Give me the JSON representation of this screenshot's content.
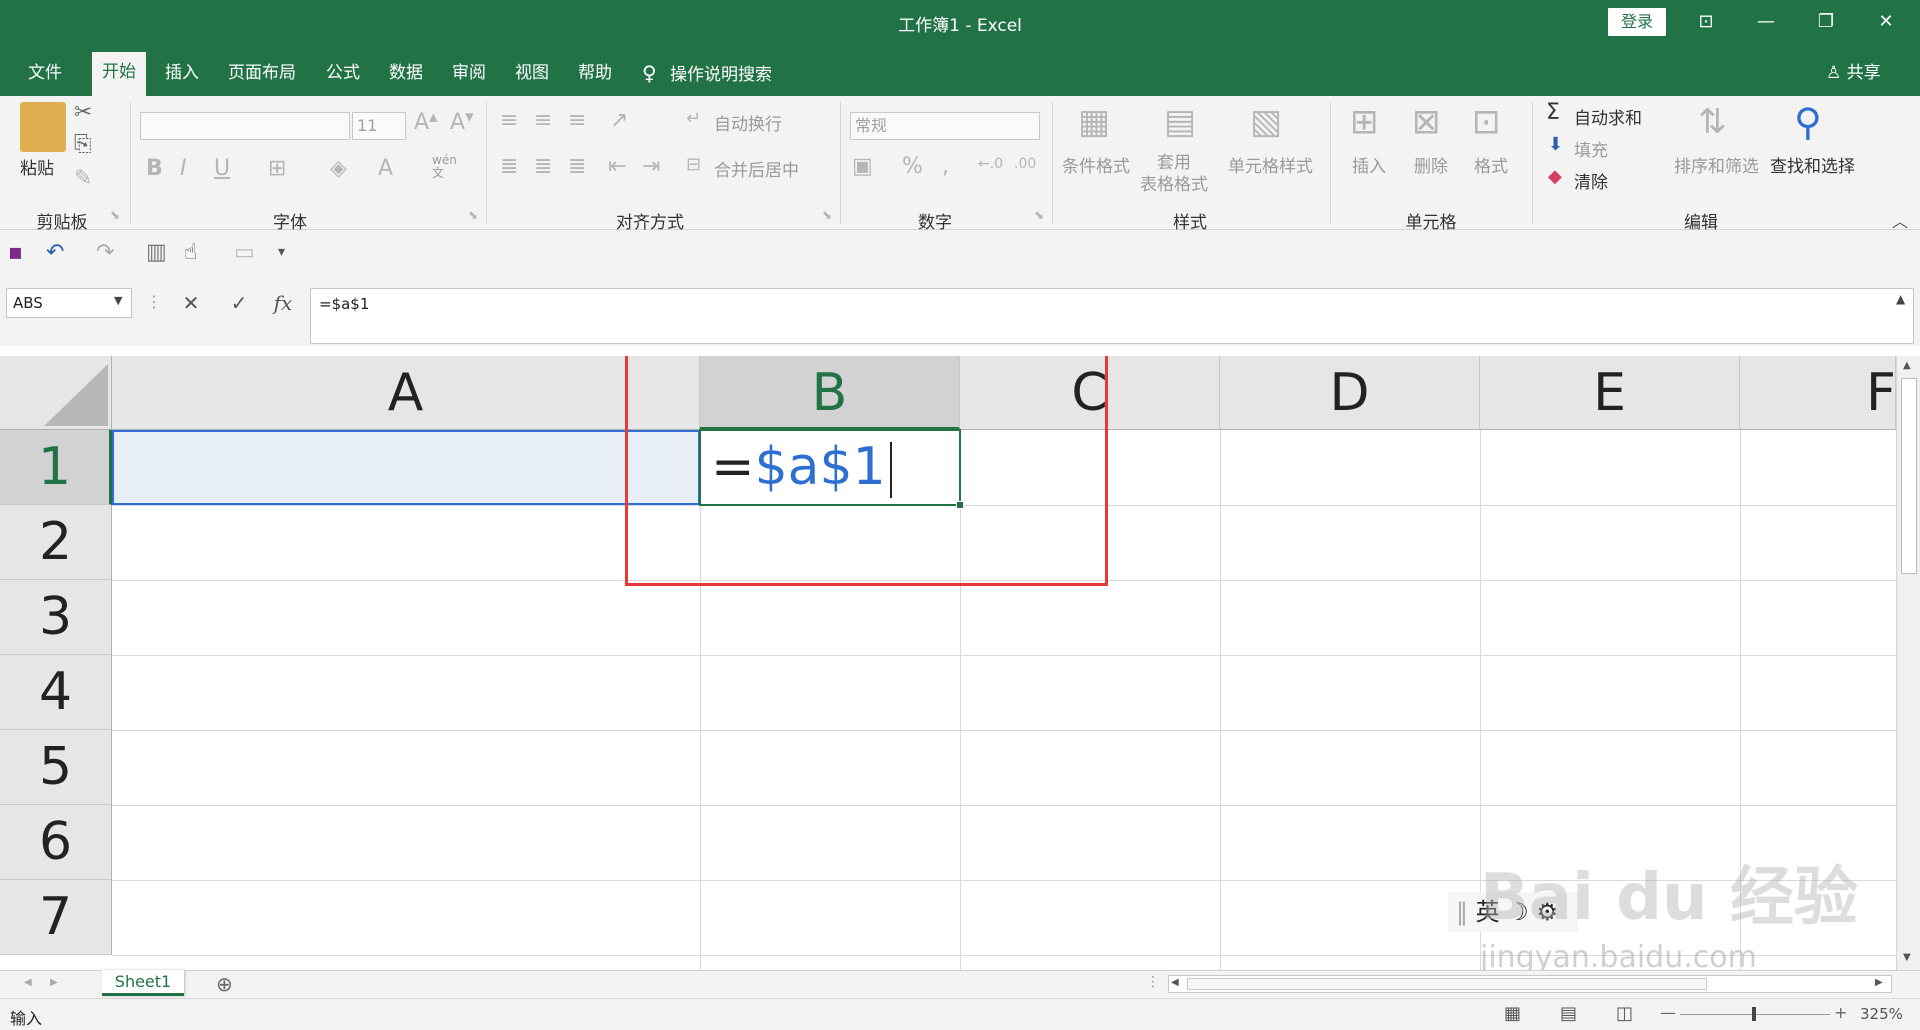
{
  "window": {
    "title": "工作簿1  -  Excel",
    "login_label": "登录",
    "controls": [
      "ribbon-display-icon",
      "minimize-icon",
      "restore-icon",
      "close-icon"
    ]
  },
  "tabs": [
    {
      "label": "文件",
      "active": false
    },
    {
      "label": "开始",
      "active": true
    },
    {
      "label": "插入",
      "active": false
    },
    {
      "label": "页面布局",
      "active": false
    },
    {
      "label": "公式",
      "active": false
    },
    {
      "label": "数据",
      "active": false
    },
    {
      "label": "审阅",
      "active": false
    },
    {
      "label": "视图",
      "active": false
    },
    {
      "label": "帮助",
      "active": false
    }
  ],
  "tell_me": "操作说明搜索",
  "share": "共享",
  "ribbon": {
    "clipboard": {
      "paste": "粘贴",
      "label": "剪贴板"
    },
    "font": {
      "size": "11",
      "label": "字体",
      "phonetic": "wén\n文"
    },
    "alignment": {
      "wrap": "自动换行",
      "merge": "合并后居中",
      "label": "对齐方式"
    },
    "number": {
      "format": "常规",
      "label": "数字"
    },
    "styles": {
      "conditional": "条件格式",
      "table": "套用\n表格格式",
      "cell_styles": "单元格样式",
      "label": "样式"
    },
    "cells": {
      "insert": "插入",
      "delete": "删除",
      "format": "格式",
      "label": "单元格"
    },
    "editing": {
      "autosum": "自动求和",
      "fill": "填充",
      "clear": "清除",
      "sort": "排序和筛选",
      "find": "查找和选择",
      "label": "编辑"
    }
  },
  "formula_bar": {
    "name_box": "ABS",
    "formula": "=$a$1"
  },
  "grid": {
    "columns": [
      "A",
      "B",
      "C",
      "D",
      "E",
      "F"
    ],
    "rows": [
      "1",
      "2",
      "3",
      "4",
      "5",
      "6",
      "7"
    ],
    "active_column": "B",
    "active_row": "1",
    "edit_cell": {
      "eq": "=",
      "ref": "$a$1"
    }
  },
  "ime": {
    "lang": "英"
  },
  "sheets": [
    {
      "label": "Sheet1",
      "active": true
    }
  ],
  "status": {
    "mode": "输入",
    "zoom": "325%"
  },
  "watermark": {
    "brand": "Bai du 经验",
    "url": "jingyan.baidu.com"
  },
  "colors": {
    "excel_green": "#217346",
    "ref_blue": "#2e6fd1",
    "highlight_red": "#e63a3a",
    "range_fill": "#e8eef8"
  }
}
